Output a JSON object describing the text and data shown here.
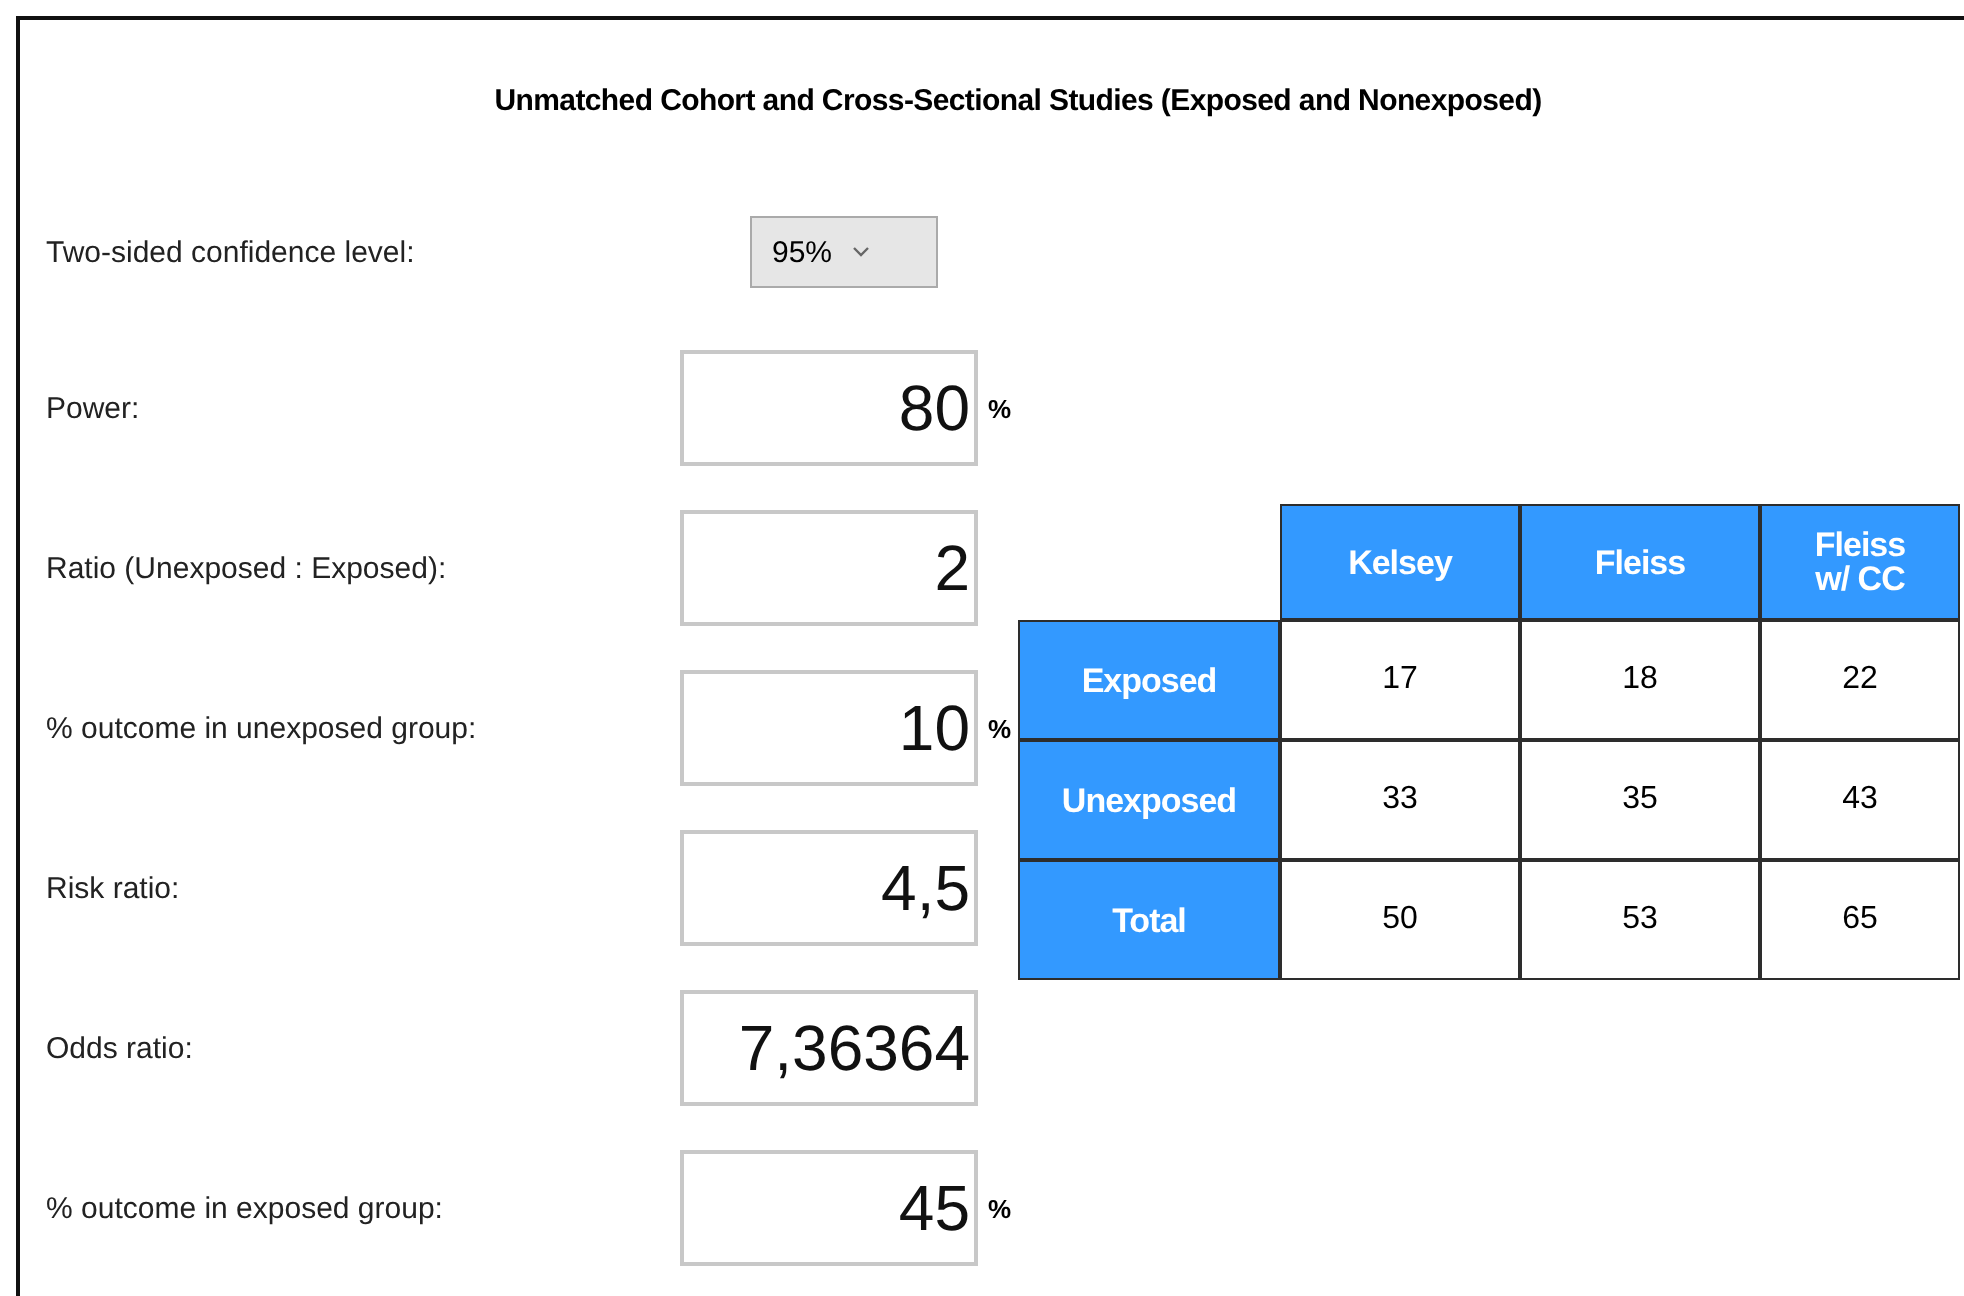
{
  "title": "Unmatched Cohort and Cross-Sectional Studies (Exposed and Nonexposed)",
  "confidence": {
    "label": "Two-sided confidence level:",
    "value": "95%"
  },
  "fields": [
    {
      "label": "Power:",
      "value": "80",
      "unit": "%"
    },
    {
      "label": "Ratio (Unexposed : Exposed):",
      "value": "2"
    },
    {
      "label": "% outcome in unexposed group:",
      "value": "10",
      "unit": "%"
    },
    {
      "label": "Risk ratio:",
      "value": "4,5"
    },
    {
      "label": "Odds ratio:",
      "value": "7,36364"
    },
    {
      "label": "% outcome in exposed group:",
      "value": "45",
      "unit": "%"
    }
  ],
  "table": {
    "columns": [
      "Kelsey",
      "Fleiss",
      "Fleiss\nw/ CC"
    ],
    "rows": [
      {
        "label": "Exposed",
        "values": [
          "17",
          "18",
          "22"
        ]
      },
      {
        "label": "Unexposed",
        "values": [
          "33",
          "35",
          "43"
        ]
      },
      {
        "label": "Total",
        "values": [
          "50",
          "53",
          "65"
        ]
      }
    ]
  }
}
